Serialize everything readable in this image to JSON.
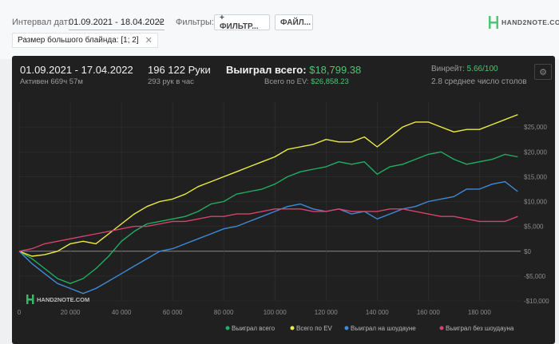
{
  "filters": {
    "date_label": "Интервал дат:",
    "date_value": "01.09.2021 - 18.04.2022",
    "filters_label": "Фильтры:",
    "add_filter_button": "+ ФИЛЬТР...",
    "file_button": "ФАЙЛ...",
    "active_chip": "Размер большого блайнда: [1; 2]",
    "chip_close": "✕"
  },
  "brand": {
    "top_logo_text": "HAND2NOTE.COM",
    "watermark_text": "HAND2NOTE.COM"
  },
  "stats": {
    "period": "01.09.2021 - 17.04.2022",
    "active": "Активен 669ч 57м",
    "hands": "196 122 Руки",
    "hands_per_hour": "293 рук в час",
    "won_total_label": "Выиграл всего:",
    "won_total_value": "$18,799.38",
    "ev_total_label": "Всего по EV:",
    "ev_total_value": "$26,858.23",
    "winrate_label": "Винрейт:",
    "winrate_value": "5.66/100",
    "avg_tables": "2.8 среднее число столов"
  },
  "colors": {
    "won_total": "#1fae62",
    "ev_total": "#ecec45",
    "showdown": "#3d8bd6",
    "non_showdown": "#d8416e",
    "accent": "#4cc673"
  },
  "chart_data": {
    "type": "line",
    "xlabel": "",
    "ylabel": "",
    "xlim": [
      0,
      196122
    ],
    "ylim": [
      -10000,
      30000
    ],
    "x_ticks": [
      0,
      20000,
      40000,
      60000,
      80000,
      100000,
      120000,
      140000,
      160000,
      180000
    ],
    "x_tick_labels": [
      "0",
      "20 000",
      "40 000",
      "60 000",
      "80 000",
      "100 000",
      "120 000",
      "140 000",
      "160 000",
      "180 000"
    ],
    "y_ticks": [
      25000,
      20000,
      15000,
      10000,
      5000,
      0,
      -5000,
      -10000
    ],
    "y_tick_labels": [
      "$25,000",
      "$20,000",
      "$15,000",
      "$10,000",
      "$5,000",
      "$0",
      "-$5,000",
      "-$10,000"
    ],
    "x": [
      0,
      5000,
      10000,
      15000,
      20000,
      25000,
      30000,
      35000,
      40000,
      45000,
      50000,
      55000,
      60000,
      65000,
      70000,
      75000,
      80000,
      85000,
      90000,
      95000,
      100000,
      105000,
      110000,
      115000,
      120000,
      125000,
      130000,
      135000,
      140000,
      145000,
      150000,
      155000,
      160000,
      165000,
      170000,
      175000,
      180000,
      185000,
      190000,
      195000
    ],
    "series": [
      {
        "name": "Выиграл всего",
        "values": [
          0,
          -1500,
          -3500,
          -5500,
          -6500,
          -5500,
          -3500,
          -1000,
          2000,
          4000,
          5500,
          6000,
          6500,
          7000,
          8000,
          9500,
          10000,
          11500,
          12000,
          12500,
          13500,
          15000,
          16000,
          16500,
          17000,
          18000,
          17500,
          18000,
          15500,
          17000,
          17500,
          18500,
          19500,
          20000,
          18500,
          17500,
          18000,
          18500,
          19500,
          19000
        ]
      },
      {
        "name": "Всего по EV",
        "values": [
          0,
          -1000,
          -700,
          0,
          1500,
          2000,
          1500,
          3500,
          5500,
          7500,
          9000,
          10000,
          10500,
          11500,
          13000,
          14000,
          15000,
          16000,
          17000,
          18000,
          19000,
          20500,
          21000,
          21500,
          22500,
          22000,
          22000,
          23000,
          21000,
          23000,
          25000,
          26000,
          26000,
          25000,
          24000,
          24500,
          24500,
          25500,
          26500,
          27500
        ]
      },
      {
        "name": "Выиграл на шоудауне",
        "values": [
          0,
          -2500,
          -4500,
          -6500,
          -7500,
          -8500,
          -7500,
          -6000,
          -4500,
          -3000,
          -1500,
          0,
          500,
          1500,
          2500,
          3500,
          4500,
          5000,
          6000,
          7000,
          8000,
          9000,
          9500,
          8500,
          8000,
          8500,
          7500,
          8000,
          6500,
          7500,
          8500,
          9000,
          10000,
          10500,
          11000,
          12500,
          12500,
          13500,
          14000,
          12000
        ]
      },
      {
        "name": "Выиграл без шоудауна",
        "values": [
          0,
          500,
          1500,
          2000,
          2500,
          3000,
          3500,
          4000,
          4500,
          5000,
          5000,
          5500,
          6000,
          6000,
          6500,
          7000,
          7000,
          7500,
          7500,
          8000,
          8500,
          8500,
          8500,
          8000,
          8000,
          8500,
          8000,
          8000,
          8000,
          8500,
          8500,
          8000,
          7500,
          7000,
          7000,
          6500,
          6000,
          6000,
          6000,
          7000
        ]
      }
    ],
    "legend_position": "bottom-right",
    "grid": true
  }
}
